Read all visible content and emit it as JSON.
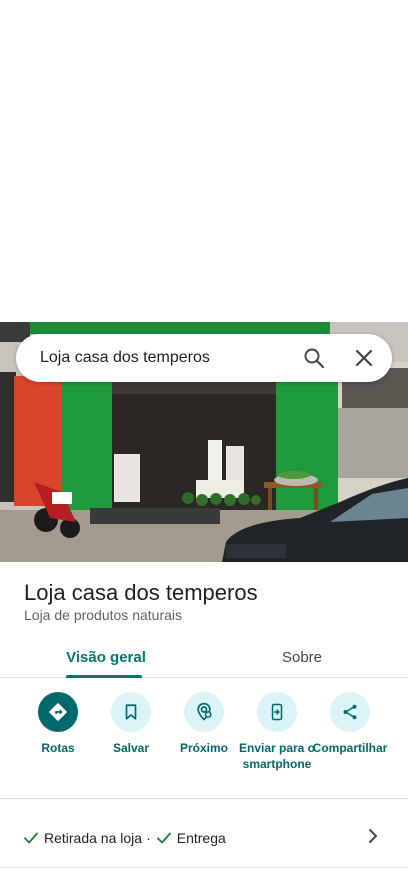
{
  "search": {
    "query": "Loja casa dos temperos"
  },
  "place": {
    "name": "Loja casa dos temperos",
    "category": "Loja de produtos naturais"
  },
  "tabs": [
    {
      "label": "Visão geral",
      "active": true
    },
    {
      "label": "Sobre",
      "active": false
    }
  ],
  "actions": [
    {
      "label": "Rotas",
      "icon": "directions-icon"
    },
    {
      "label": "Salvar",
      "icon": "bookmark-icon"
    },
    {
      "label": "Próximo",
      "icon": "nearby-icon"
    },
    {
      "label": "Enviar para o smartphone",
      "icon": "send-to-phone-icon"
    },
    {
      "label": "Compartilhar",
      "icon": "share-icon"
    }
  ],
  "services": {
    "item1": "Retirada na loja",
    "separator": "·",
    "item2": "Entrega"
  },
  "colors": {
    "accent": "#00796b",
    "action_bg": "#d9f3f6",
    "primary_action": "#00696b",
    "check": "#188038"
  }
}
